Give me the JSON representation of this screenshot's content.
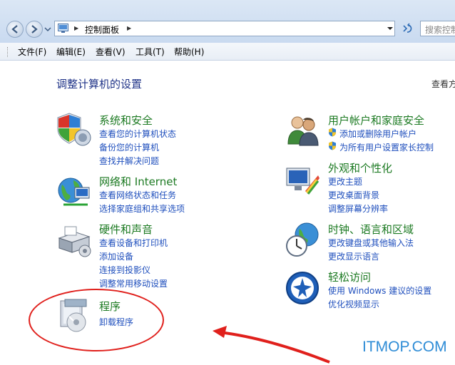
{
  "address": {
    "path": "控制面板"
  },
  "search": {
    "placeholder": "搜索控制"
  },
  "menu": [
    "文件(F)",
    "编辑(E)",
    "查看(V)",
    "工具(T)",
    "帮助(H)"
  ],
  "main": {
    "heading": "调整计算机的设置",
    "view_by": "查看方"
  },
  "categories": [
    {
      "title": "系统和安全",
      "links": [
        "查看您的计算机状态",
        "备份您的计算机",
        "查找并解决问题"
      ]
    },
    {
      "title": "网络和 Internet",
      "links": [
        "查看网络状态和任务",
        "选择家庭组和共享选项"
      ]
    },
    {
      "title": "硬件和声音",
      "links": [
        "查看设备和打印机",
        "添加设备",
        "连接到投影仪",
        "调整常用移动设置"
      ]
    },
    {
      "title": "程序",
      "links": [
        "卸载程序"
      ]
    },
    {
      "title": "用户帐户和家庭安全",
      "links": [
        "添加或删除用户帐户",
        "为所有用户设置家长控制"
      ]
    },
    {
      "title": "外观和个性化",
      "links": [
        "更改主题",
        "更改桌面背景",
        "调整屏幕分辨率"
      ]
    },
    {
      "title": "时钟、语言和区域",
      "links": [
        "更改键盘或其他输入法",
        "更改显示语言"
      ]
    },
    {
      "title": "轻松访问",
      "links": [
        "使用 Windows 建议的设置",
        "优化视频显示"
      ]
    }
  ],
  "watermark": "ITMOP.COM",
  "colors": {
    "category_title": "#1c7a22",
    "link": "#1f4fbd",
    "annotation": "#e0201c",
    "watermark": "#2e8cd6"
  }
}
